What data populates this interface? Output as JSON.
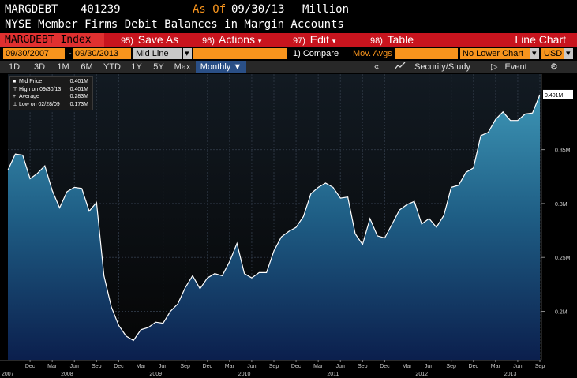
{
  "header": {
    "ticker": "MARGDEBT",
    "code": "401239",
    "as_of_label": "As Of",
    "as_of_date": "09/30/13",
    "units": "Million",
    "description": "NYSE Member Firms Debit Balances in Margin Accounts"
  },
  "menu": {
    "index_label": "MARGDEBT Index",
    "save_num": "95)",
    "save_label": "Save As",
    "actions_num": "96)",
    "actions_label": "Actions",
    "edit_num": "97)",
    "edit_label": "Edit",
    "table_num": "98)",
    "table_label": "Table",
    "chart_type": "Line Chart"
  },
  "options": {
    "start_date": "09/30/2007",
    "end_date": "09/30/2013",
    "price_field": "Mid Line",
    "compare": "1) Compare",
    "mov_avgs": "Mov. Avgs",
    "lower_chart": "No Lower Chart",
    "currency": "USD"
  },
  "periods": {
    "tabs": [
      "1D",
      "3D",
      "1M",
      "6M",
      "YTD",
      "1Y",
      "5Y",
      "Max"
    ],
    "frequency": "Monthly",
    "security_study": "Security/Study",
    "event": "Event"
  },
  "legend": {
    "rows": [
      {
        "label": "Mid Price",
        "value": "0.401M"
      },
      {
        "label": "High on 09/30/13",
        "value": "0.401M"
      },
      {
        "label": "Average",
        "value": "0.283M"
      },
      {
        "label": "Low on 02/28/09",
        "value": "0.173M"
      }
    ]
  },
  "colors": {
    "accent_red": "#c8141e",
    "orange": "#f7941d",
    "area_top": "#3a8fb0",
    "area_bottom": "#0a1a40",
    "line": "#ffffff"
  },
  "chart_data": {
    "type": "area",
    "series": [
      {
        "name": "Mid Price",
        "x": [
          "2007-09",
          "2007-10",
          "2007-11",
          "2007-12",
          "2008-01",
          "2008-02",
          "2008-03",
          "2008-04",
          "2008-05",
          "2008-06",
          "2008-07",
          "2008-08",
          "2008-09",
          "2008-10",
          "2008-11",
          "2008-12",
          "2009-01",
          "2009-02",
          "2009-03",
          "2009-04",
          "2009-05",
          "2009-06",
          "2009-07",
          "2009-08",
          "2009-09",
          "2009-10",
          "2009-11",
          "2009-12",
          "2010-01",
          "2010-02",
          "2010-03",
          "2010-04",
          "2010-05",
          "2010-06",
          "2010-07",
          "2010-08",
          "2010-09",
          "2010-10",
          "2010-11",
          "2010-12",
          "2011-01",
          "2011-02",
          "2011-03",
          "2011-04",
          "2011-05",
          "2011-06",
          "2011-07",
          "2011-08",
          "2011-09",
          "2011-10",
          "2011-11",
          "2011-12",
          "2012-01",
          "2012-02",
          "2012-03",
          "2012-04",
          "2012-05",
          "2012-06",
          "2012-07",
          "2012-08",
          "2012-09",
          "2012-10",
          "2012-11",
          "2012-12",
          "2013-01",
          "2013-02",
          "2013-03",
          "2013-04",
          "2013-05",
          "2013-06",
          "2013-07",
          "2013-08",
          "2013-09"
        ],
        "values": [
          0.331,
          0.346,
          0.345,
          0.323,
          0.328,
          0.335,
          0.312,
          0.296,
          0.311,
          0.315,
          0.314,
          0.293,
          0.301,
          0.233,
          0.204,
          0.187,
          0.177,
          0.173,
          0.183,
          0.185,
          0.19,
          0.189,
          0.2,
          0.207,
          0.222,
          0.233,
          0.221,
          0.231,
          0.235,
          0.233,
          0.246,
          0.263,
          0.235,
          0.231,
          0.236,
          0.236,
          0.256,
          0.269,
          0.274,
          0.278,
          0.288,
          0.309,
          0.315,
          0.319,
          0.315,
          0.305,
          0.306,
          0.272,
          0.262,
          0.286,
          0.27,
          0.268,
          0.281,
          0.294,
          0.299,
          0.302,
          0.281,
          0.286,
          0.278,
          0.289,
          0.315,
          0.317,
          0.329,
          0.333,
          0.363,
          0.366,
          0.378,
          0.385,
          0.377,
          0.377,
          0.383,
          0.384,
          0.401
        ]
      }
    ],
    "x_tick_labels": [
      "Dec",
      "Mar",
      "Jun",
      "Sep",
      "Dec",
      "Mar",
      "Jun",
      "Sep",
      "Dec",
      "Mar",
      "Jun",
      "Sep",
      "Dec",
      "Mar",
      "Jun",
      "Sep",
      "Dec",
      "Mar",
      "Jun",
      "Sep",
      "Dec",
      "Mar",
      "Jun",
      "Sep"
    ],
    "x_tick_positions": [
      "2007-12",
      "2008-03",
      "2008-06",
      "2008-09",
      "2008-12",
      "2009-03",
      "2009-06",
      "2009-09",
      "2009-12",
      "2010-03",
      "2010-06",
      "2010-09",
      "2010-12",
      "2011-03",
      "2011-06",
      "2011-09",
      "2011-12",
      "2012-03",
      "2012-06",
      "2012-09",
      "2012-12",
      "2013-03",
      "2013-06",
      "2013-09"
    ],
    "year_labels": [
      "2007",
      "2008",
      "2009",
      "2010",
      "2011",
      "2012",
      "2013"
    ],
    "year_positions": [
      "2007-09",
      "2008-05",
      "2009-05",
      "2010-05",
      "2011-05",
      "2012-05",
      "2013-05"
    ],
    "y_ticks": [
      0.2,
      0.25,
      0.3,
      0.35
    ],
    "y_tick_labels": [
      "0.2M",
      "0.25M",
      "0.3M",
      "0.35M"
    ],
    "last_value_label": "0.401M",
    "ylim": [
      0.155,
      0.42
    ],
    "grid": true
  }
}
